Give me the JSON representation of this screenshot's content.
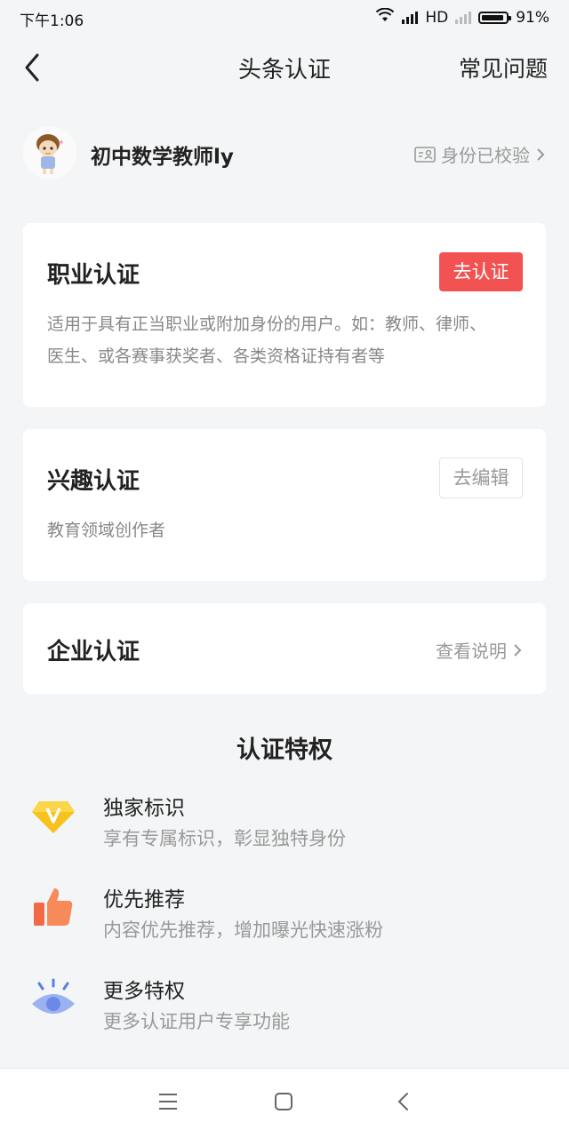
{
  "status_bar": {
    "time": "下午1:06",
    "network": "HD",
    "battery": "91%",
    "battery_level": 0.91
  },
  "nav": {
    "title": "头条认证",
    "faq": "常见问题"
  },
  "profile": {
    "username": "初中数学教师ly",
    "identity_status": "身份已校验"
  },
  "cards": {
    "career": {
      "title": "职业认证",
      "button": "去认证",
      "desc_line1": "适用于具有正当职业或附加身份的用户。如：教师、律师、",
      "desc_line2": "医生、或各赛事获奖者、各类资格证持有者等"
    },
    "interest": {
      "title": "兴趣认证",
      "button": "去编辑",
      "desc": "教育领域创作者"
    },
    "enterprise": {
      "title": "企业认证",
      "link": "查看说明"
    }
  },
  "privileges": {
    "heading": "认证特权",
    "items": [
      {
        "title": "独家标识",
        "subtitle": "享有专属标识，彰显独特身份",
        "icon": "diamond-v-icon"
      },
      {
        "title": "优先推荐",
        "subtitle": "内容优先推荐，增加曝光快速涨粉",
        "icon": "thumbs-up-icon"
      },
      {
        "title": "更多特权",
        "subtitle": "更多认证用户专享功能",
        "icon": "eye-icon"
      }
    ]
  },
  "colors": {
    "accent": "#f25252",
    "background": "#f4f5f6",
    "diamond": "#f7c21f",
    "thumb": "#f26a45",
    "eye": "#8fa8f0"
  }
}
